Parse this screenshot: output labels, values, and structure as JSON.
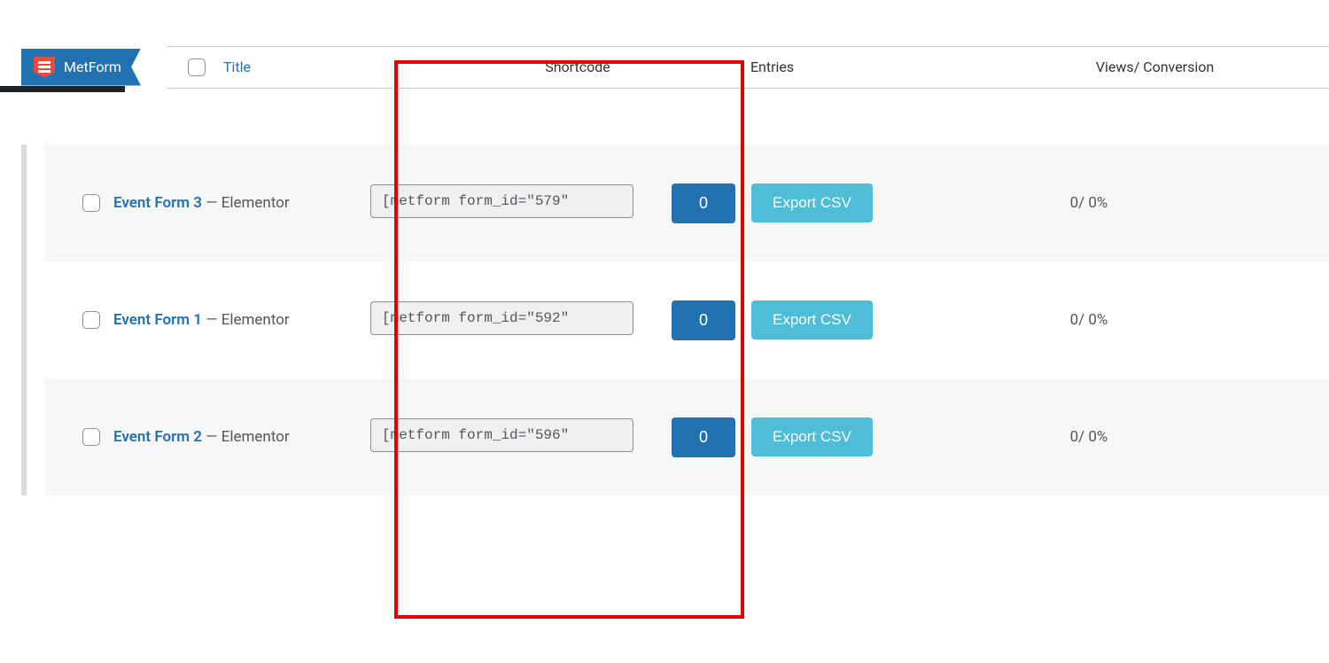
{
  "menu": {
    "label": "MetForm"
  },
  "headers": {
    "title": "Title",
    "shortcode": "Shortcode",
    "entries": "Entries",
    "views": "Views/ Conversion"
  },
  "rows": [
    {
      "title": "Event Form 3",
      "editor": "Elementor",
      "shortcode": "[metform form_id=\"579\"",
      "entries": "0",
      "export": "Export CSV",
      "views": "0/ 0%"
    },
    {
      "title": "Event Form 1",
      "editor": "Elementor",
      "shortcode": "[metform form_id=\"592\"",
      "entries": "0",
      "export": "Export CSV",
      "views": "0/ 0%"
    },
    {
      "title": "Event Form 2",
      "editor": "Elementor",
      "shortcode": "[metform form_id=\"596\"",
      "entries": "0",
      "export": "Export CSV",
      "views": "0/ 0%"
    }
  ],
  "dash": " — "
}
